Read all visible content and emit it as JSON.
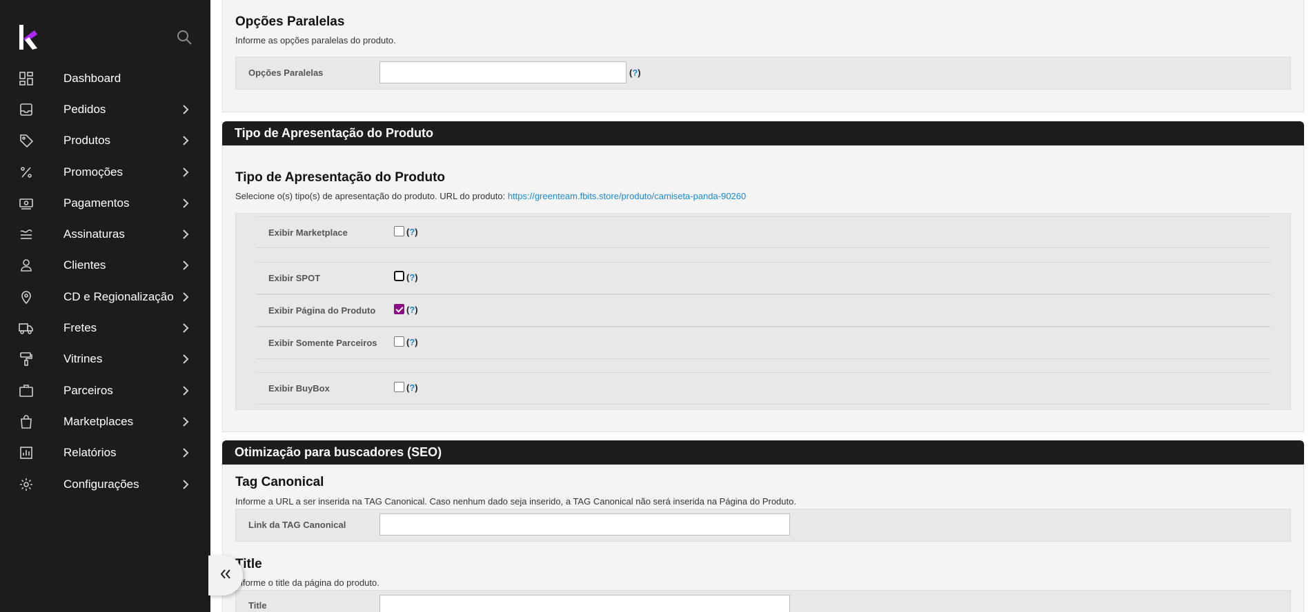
{
  "sidebar": {
    "items": [
      {
        "label": "Dashboard",
        "icon": "dashboard-icon",
        "has_submenu": false
      },
      {
        "label": "Pedidos",
        "icon": "inbox-icon",
        "has_submenu": true
      },
      {
        "label": "Produtos",
        "icon": "tag-icon",
        "has_submenu": true
      },
      {
        "label": "Promoções",
        "icon": "percent-icon",
        "has_submenu": true
      },
      {
        "label": "Pagamentos",
        "icon": "cash-icon",
        "has_submenu": true
      },
      {
        "label": "Assinaturas",
        "icon": "waves-icon",
        "has_submenu": true
      },
      {
        "label": "Clientes",
        "icon": "user-icon",
        "has_submenu": true
      },
      {
        "label": "CD e Regionalização",
        "icon": "location-pin-icon",
        "has_submenu": true
      },
      {
        "label": "Fretes",
        "icon": "truck-icon",
        "has_submenu": true
      },
      {
        "label": "Vitrines",
        "icon": "paint-roller-icon",
        "has_submenu": true
      },
      {
        "label": "Parceiros",
        "icon": "briefcase-icon",
        "has_submenu": true
      },
      {
        "label": "Marketplaces",
        "icon": "shopping-bag-icon",
        "has_submenu": true
      },
      {
        "label": "Relatórios",
        "icon": "report-chart-icon",
        "has_submenu": true
      },
      {
        "label": "Configurações",
        "icon": "gear-icon",
        "has_submenu": true
      }
    ]
  },
  "parallel": {
    "title": "Opções Paralelas",
    "description": "Informe as opções paralelas do produto.",
    "field_label": "Opções Paralelas",
    "field_value": "",
    "help_open": "(",
    "help_q": "?",
    "help_close": ")"
  },
  "presentation": {
    "header": "Tipo de Apresentação do Produto",
    "title": "Tipo de Apresentação do Produto",
    "description": "Selecione o(s) tipo(s) de apresentação do produto. URL do produto: ",
    "url": "https://greenteam.fbits.store/produto/camiseta-panda-90260",
    "options": [
      {
        "label": "Exibir Marketplace",
        "checked": false
      },
      {
        "label": "Exibir SPOT",
        "checked": false
      },
      {
        "label": "Exibir Página do Produto",
        "checked": true
      },
      {
        "label": "Exibir Somente Parceiros",
        "checked": false
      },
      {
        "label": "Exibir BuyBox",
        "checked": false
      }
    ]
  },
  "seo": {
    "header": "Otimização para buscadores (SEO)",
    "canonical_title": "Tag Canonical",
    "canonical_desc": "Informe a URL a ser inserida na TAG Canonical. Caso nenhum dado seja inserido, a TAG Canonical não será inserida na Página do Produto.",
    "canonical_label": "Link da TAG Canonical",
    "canonical_value": "",
    "title_title": "Title",
    "title_desc": "Informe o title da página do produto.",
    "title_label": "Title",
    "title_value": ""
  },
  "colors": {
    "sidebar_bg": "#1b1c1e",
    "header_bg": "#1d1d1d",
    "accent_link": "#1a8ad4",
    "checkbox_checked": "#8b0c84",
    "logo_purple": "#b026ff"
  }
}
